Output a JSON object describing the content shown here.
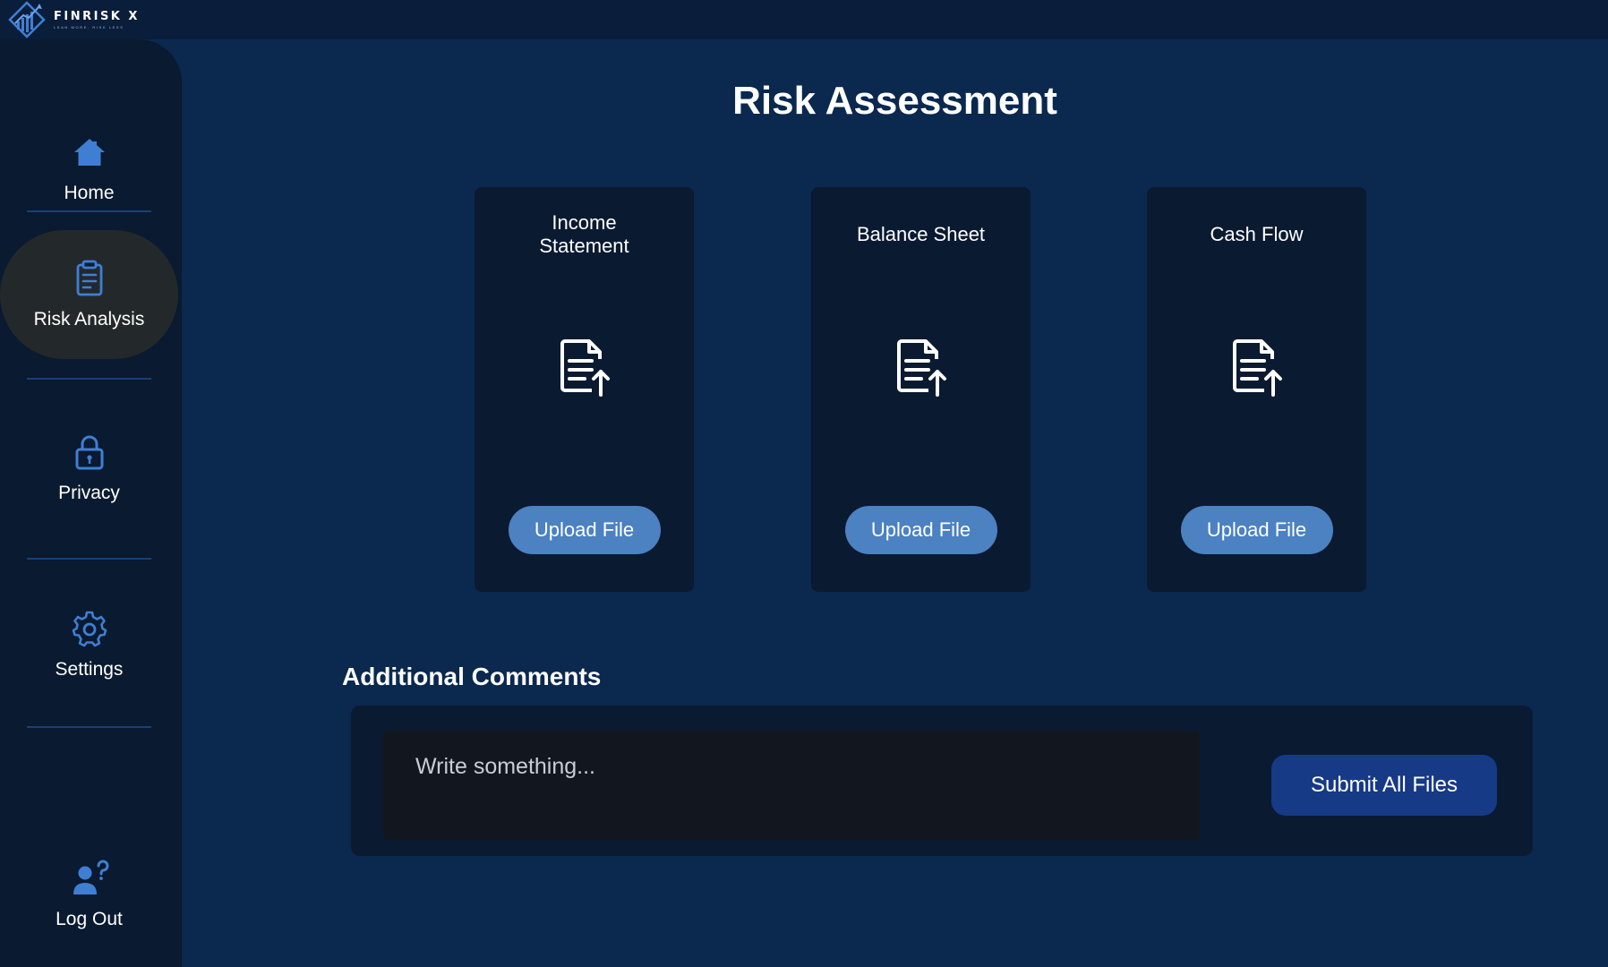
{
  "app": {
    "brand_name": "FINRISK X",
    "brand_tagline": "LEAN MORE, RISK LESS"
  },
  "sidebar": {
    "items": [
      {
        "label": "Home",
        "icon": "home-icon"
      },
      {
        "label": "Risk Analysis",
        "icon": "clipboard-icon",
        "active": true
      },
      {
        "label": "Privacy",
        "icon": "lock-icon"
      },
      {
        "label": "Settings",
        "icon": "gear-icon"
      },
      {
        "label": "Log Out",
        "icon": "user-question-icon"
      }
    ]
  },
  "main": {
    "title": "Risk Assessment",
    "cards": [
      {
        "title": "Income Statement",
        "icon": "file-upload-icon",
        "button_label": "Upload File"
      },
      {
        "title": "Balance Sheet",
        "icon": "file-upload-icon",
        "button_label": "Upload File"
      },
      {
        "title": "Cash Flow",
        "icon": "file-upload-icon",
        "button_label": "Upload File"
      }
    ],
    "comments": {
      "heading": "Additional Comments",
      "placeholder": "Write something...",
      "value": "",
      "submit_label": "Submit All Files"
    }
  },
  "colors": {
    "background": "#0b284f",
    "topbar": "#0a1d3a",
    "sidebar": "#0a1a30",
    "card": "#0a1a31",
    "accent_icon": "#3f7fd3",
    "upload_button": "#4c81c2",
    "submit_button": "#173a87",
    "active_nav": "#23292b"
  }
}
